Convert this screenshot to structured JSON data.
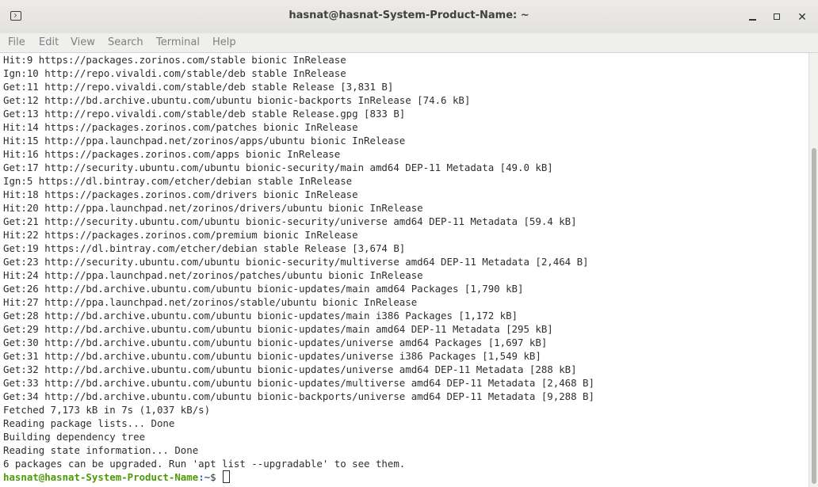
{
  "window": {
    "title": "hasnat@hasnat-System-Product-Name: ~"
  },
  "menu": [
    "File",
    "Edit",
    "View",
    "Search",
    "Terminal",
    "Help"
  ],
  "lines": [
    "Hit:9 https://packages.zorinos.com/stable bionic InRelease",
    "Ign:10 http://repo.vivaldi.com/stable/deb stable InRelease",
    "Get:11 http://repo.vivaldi.com/stable/deb stable Release [3,831 B]",
    "Get:12 http://bd.archive.ubuntu.com/ubuntu bionic-backports InRelease [74.6 kB]",
    "Get:13 http://repo.vivaldi.com/stable/deb stable Release.gpg [833 B]",
    "Hit:14 https://packages.zorinos.com/patches bionic InRelease",
    "Hit:15 http://ppa.launchpad.net/zorinos/apps/ubuntu bionic InRelease",
    "Hit:16 https://packages.zorinos.com/apps bionic InRelease",
    "Get:17 http://security.ubuntu.com/ubuntu bionic-security/main amd64 DEP-11 Metadata [49.0 kB]",
    "Ign:5 https://dl.bintray.com/etcher/debian stable InRelease",
    "Hit:18 https://packages.zorinos.com/drivers bionic InRelease",
    "Hit:20 http://ppa.launchpad.net/zorinos/drivers/ubuntu bionic InRelease",
    "Get:21 http://security.ubuntu.com/ubuntu bionic-security/universe amd64 DEP-11 Metadata [59.4 kB]",
    "Hit:22 https://packages.zorinos.com/premium bionic InRelease",
    "Get:19 https://dl.bintray.com/etcher/debian stable Release [3,674 B]",
    "Get:23 http://security.ubuntu.com/ubuntu bionic-security/multiverse amd64 DEP-11 Metadata [2,464 B]",
    "Hit:24 http://ppa.launchpad.net/zorinos/patches/ubuntu bionic InRelease",
    "Get:26 http://bd.archive.ubuntu.com/ubuntu bionic-updates/main amd64 Packages [1,790 kB]",
    "Hit:27 http://ppa.launchpad.net/zorinos/stable/ubuntu bionic InRelease",
    "Get:28 http://bd.archive.ubuntu.com/ubuntu bionic-updates/main i386 Packages [1,172 kB]",
    "Get:29 http://bd.archive.ubuntu.com/ubuntu bionic-updates/main amd64 DEP-11 Metadata [295 kB]",
    "Get:30 http://bd.archive.ubuntu.com/ubuntu bionic-updates/universe amd64 Packages [1,697 kB]",
    "Get:31 http://bd.archive.ubuntu.com/ubuntu bionic-updates/universe i386 Packages [1,549 kB]",
    "Get:32 http://bd.archive.ubuntu.com/ubuntu bionic-updates/universe amd64 DEP-11 Metadata [288 kB]",
    "Get:33 http://bd.archive.ubuntu.com/ubuntu bionic-updates/multiverse amd64 DEP-11 Metadata [2,468 B]",
    "Get:34 http://bd.archive.ubuntu.com/ubuntu bionic-backports/universe amd64 DEP-11 Metadata [9,288 B]",
    "Fetched 7,173 kB in 7s (1,037 kB/s)",
    "Reading package lists... Done",
    "Building dependency tree",
    "Reading state information... Done",
    "6 packages can be upgraded. Run 'apt list --upgradable' to see them."
  ],
  "prompt": {
    "user": "hasnat@hasnat-System-Product-Name",
    "path": ":~",
    "symbol": "$ "
  },
  "colors": {
    "prompt_user": "#4e9a06",
    "prompt_path": "#3465a4",
    "text": "#2e2e2e"
  }
}
